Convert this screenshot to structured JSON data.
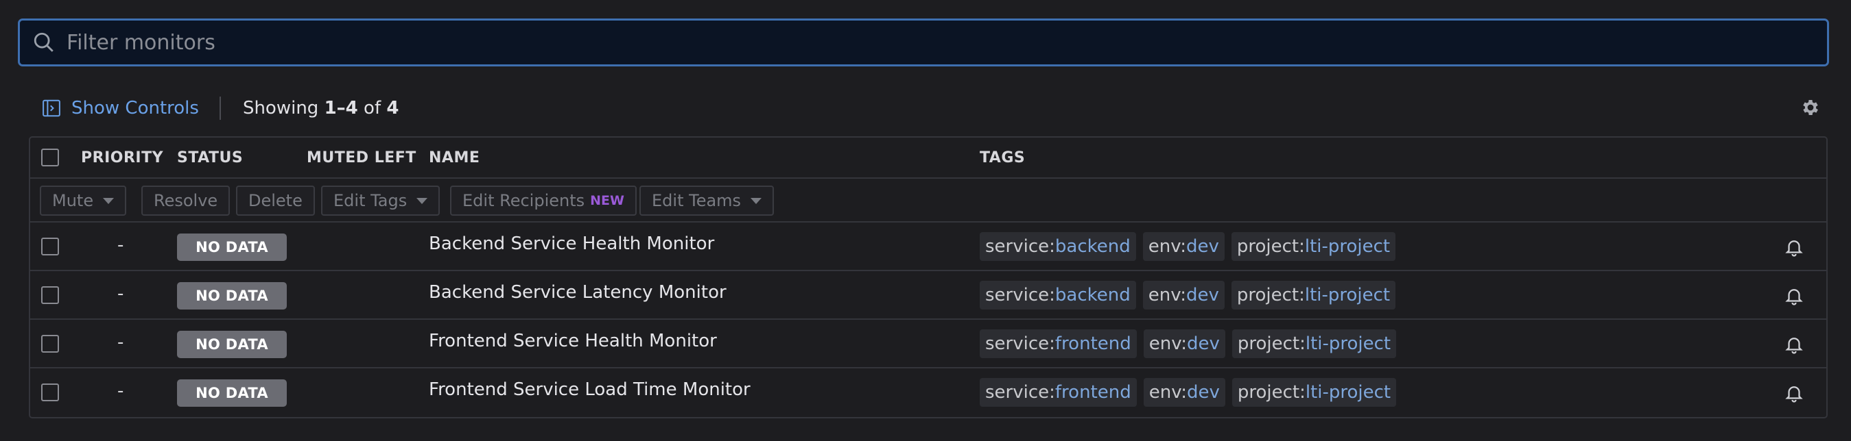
{
  "search": {
    "placeholder": "Filter monitors",
    "value": ""
  },
  "controls": {
    "show_controls": "Show Controls",
    "showing_prefix": "Showing ",
    "showing_range": "1–4",
    "showing_suffix": " of ",
    "showing_total": "4"
  },
  "table": {
    "headers": {
      "priority": "PRIORITY",
      "status": "STATUS",
      "muted_left": "MUTED LEFT",
      "name": "NAME",
      "tags": "TAGS"
    },
    "toolbar": {
      "mute": "Mute",
      "resolve": "Resolve",
      "delete": "Delete",
      "edit_tags": "Edit Tags",
      "edit_recipients": "Edit Recipients",
      "new_badge": "NEW",
      "edit_teams": "Edit Teams"
    },
    "rows": [
      {
        "priority": "-",
        "status": "NO DATA",
        "name": "Backend Service Health Monitor",
        "tags": [
          {
            "k": "service:",
            "v": "backend"
          },
          {
            "k": "env:",
            "v": "dev"
          },
          {
            "k": "project:",
            "v": "lti-project"
          }
        ]
      },
      {
        "priority": "-",
        "status": "NO DATA",
        "name": "Backend Service Latency Monitor",
        "tags": [
          {
            "k": "service:",
            "v": "backend"
          },
          {
            "k": "env:",
            "v": "dev"
          },
          {
            "k": "project:",
            "v": "lti-project"
          }
        ]
      },
      {
        "priority": "-",
        "status": "NO DATA",
        "name": "Frontend Service Health Monitor",
        "tags": [
          {
            "k": "service:",
            "v": "frontend"
          },
          {
            "k": "env:",
            "v": "dev"
          },
          {
            "k": "project:",
            "v": "lti-project"
          }
        ]
      },
      {
        "priority": "-",
        "status": "NO DATA",
        "name": "Frontend Service Load Time Monitor",
        "tags": [
          {
            "k": "service:",
            "v": "frontend"
          },
          {
            "k": "env:",
            "v": "dev"
          },
          {
            "k": "project:",
            "v": "lti-project"
          }
        ]
      }
    ]
  },
  "colors": {
    "accent": "#6aa1e8",
    "status_no_data": "#6b6c73",
    "new_badge": "#9a5ad8",
    "tag_value": "#7ea7dc"
  },
  "icons": {
    "search": "search-icon",
    "show_controls": "panel-expand-icon",
    "settings": "gear-icon",
    "notify": "bell-icon"
  }
}
